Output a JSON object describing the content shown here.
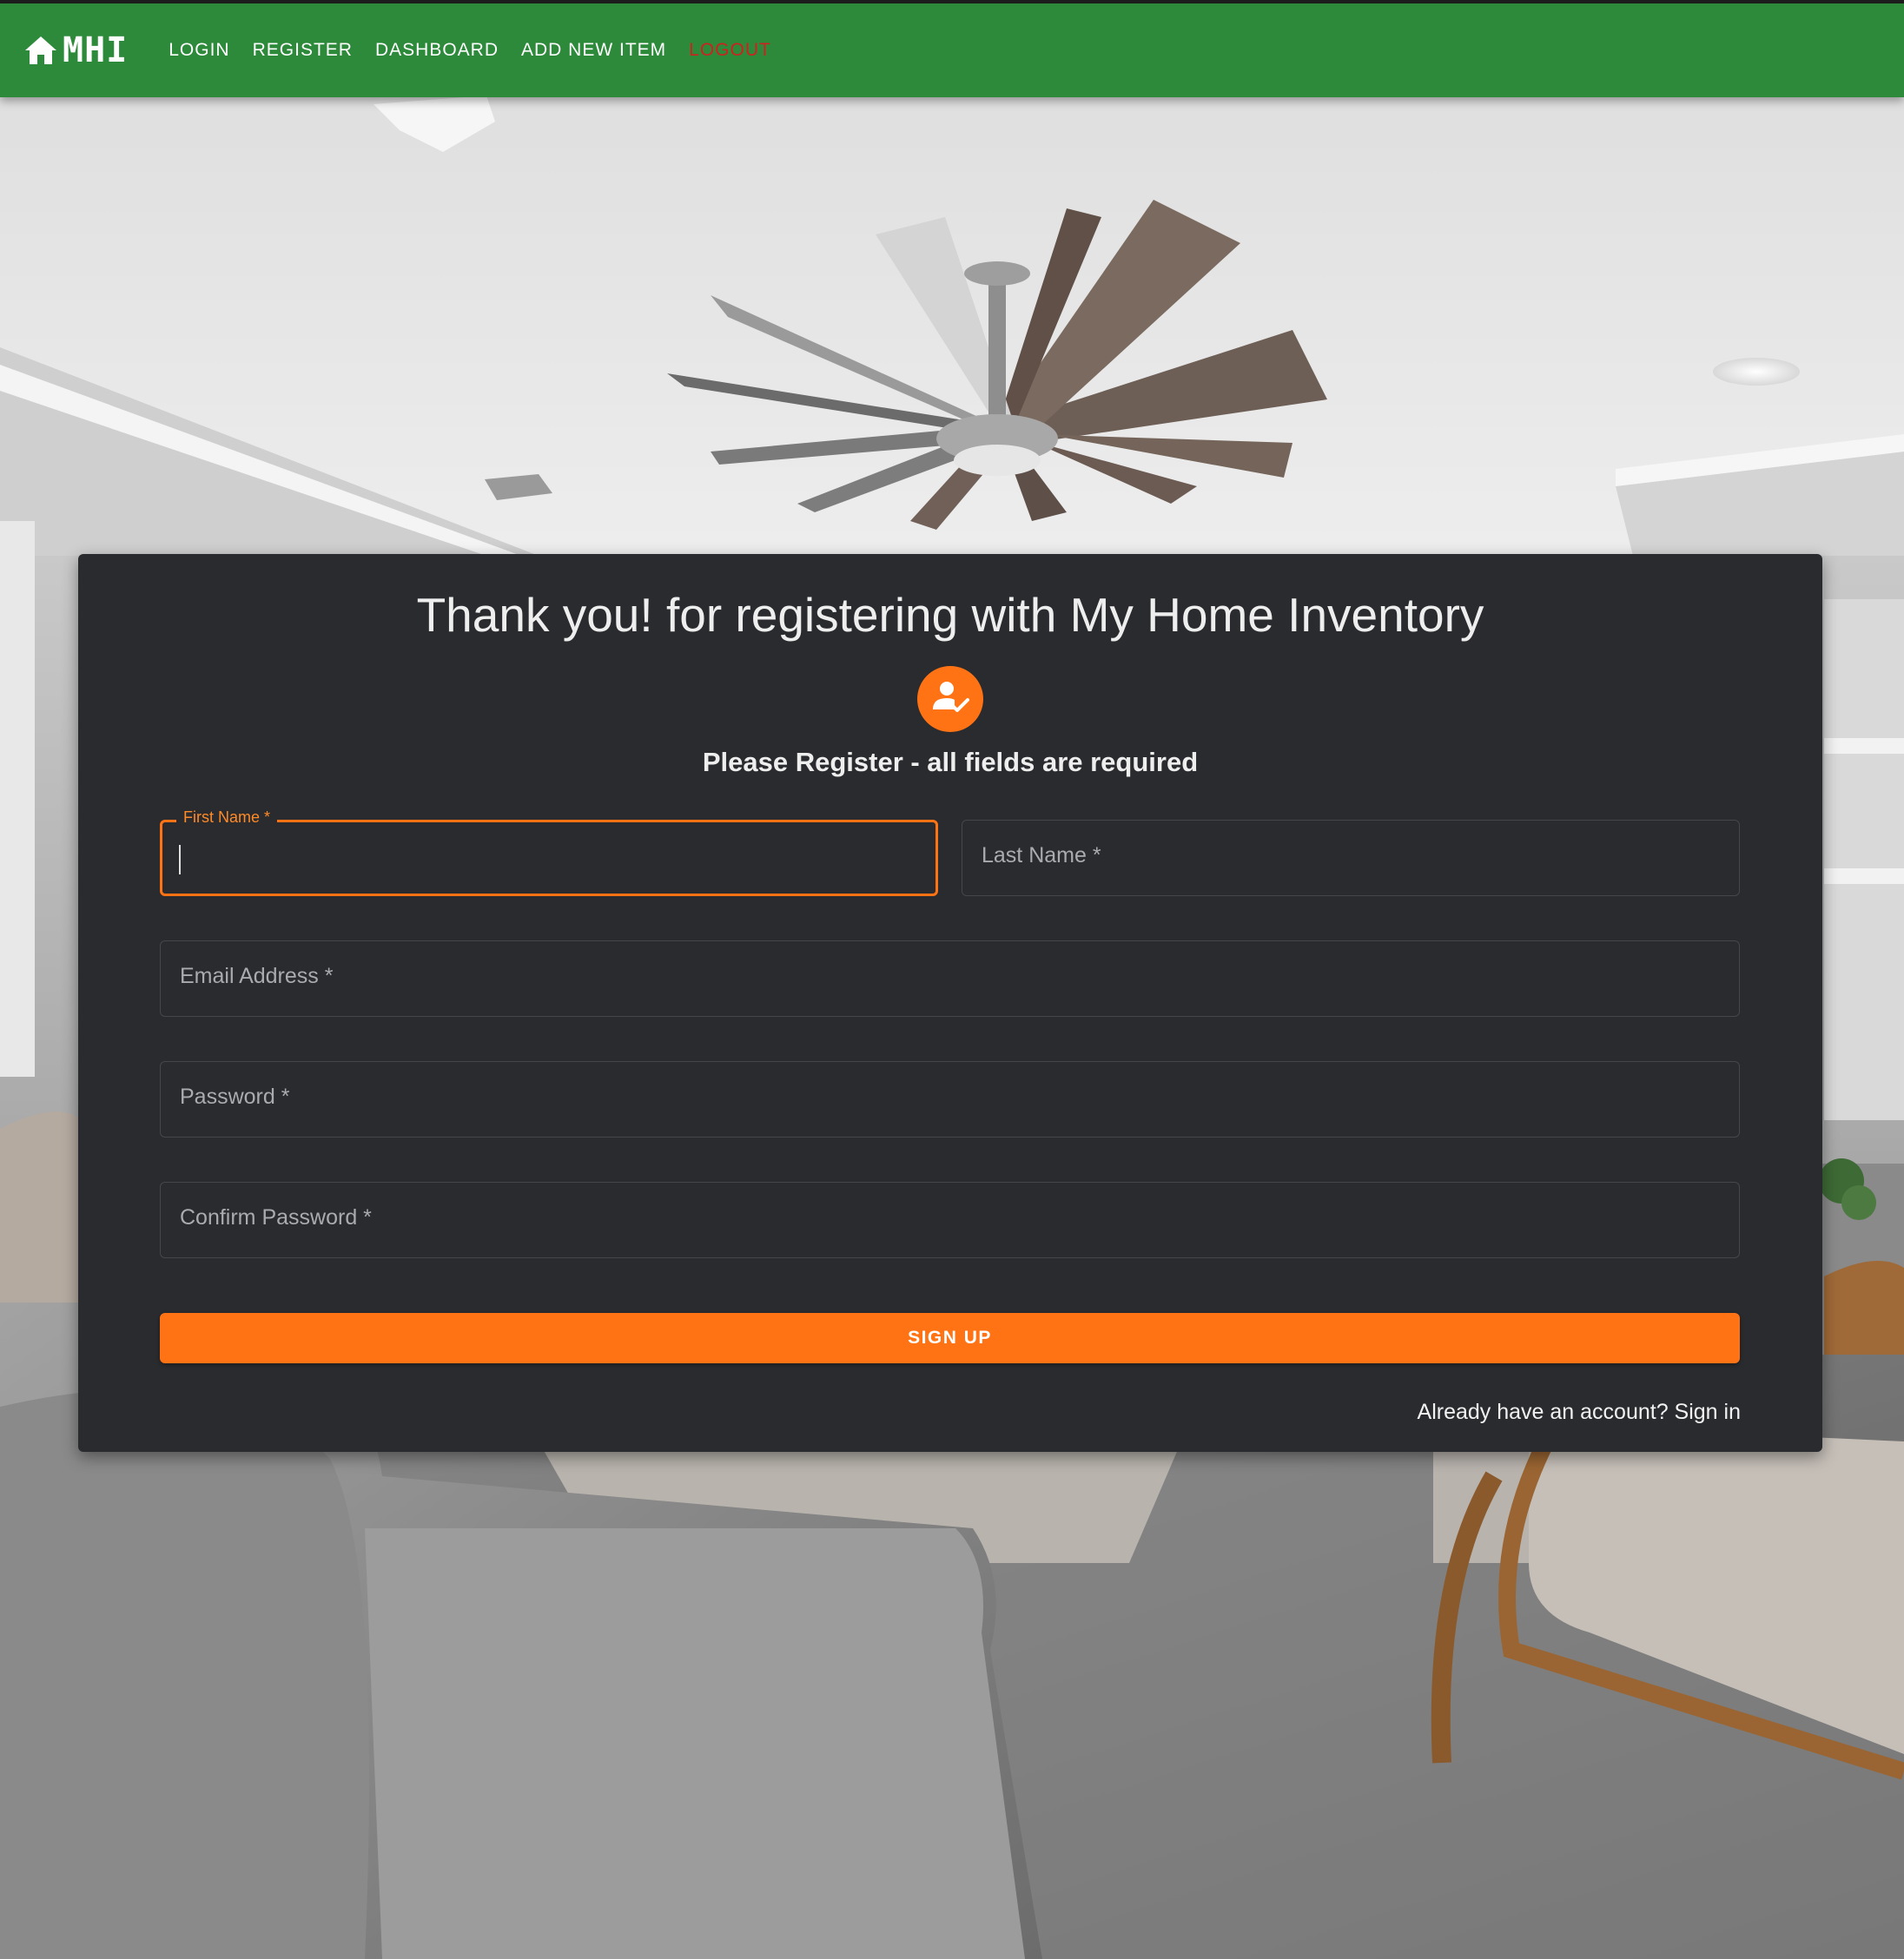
{
  "nav": {
    "brand": "MHI",
    "links": [
      {
        "label": "LOGIN"
      },
      {
        "label": "REGISTER"
      },
      {
        "label": "DASHBOARD"
      },
      {
        "label": "ADD NEW ITEM"
      },
      {
        "label": "LOGOUT"
      }
    ]
  },
  "card": {
    "title": "Thank you! for registering with My Home Inventory",
    "subtitle": "Please Register - all fields are required",
    "fields": {
      "first_name": {
        "label": "First Name *",
        "value": ""
      },
      "last_name": {
        "label": "Last Name *",
        "value": ""
      },
      "email": {
        "label": "Email Address *",
        "value": ""
      },
      "password": {
        "label": "Password *",
        "value": ""
      },
      "confirm_password": {
        "label": "Confirm Password *",
        "value": ""
      }
    },
    "signup_label": "SIGN UP",
    "signin_link": "Already have an account? Sign in"
  },
  "colors": {
    "appbar": "#2c8a3a",
    "accent": "#ff7315",
    "card": "#292b2e",
    "logout": "#d02020"
  },
  "icons": {
    "brand": "home-icon",
    "avatar": "person-check-icon"
  }
}
